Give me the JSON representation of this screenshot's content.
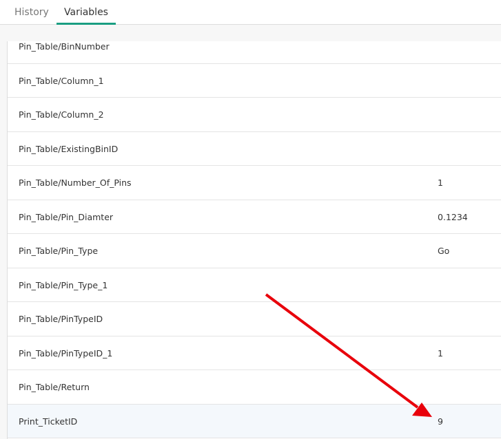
{
  "tabs": [
    {
      "label": "History"
    },
    {
      "label": "Variables",
      "active": true
    }
  ],
  "rows": [
    {
      "name": "Pin_Table/BinNumber",
      "value": ""
    },
    {
      "name": "Pin_Table/Column_1",
      "value": ""
    },
    {
      "name": "Pin_Table/Column_2",
      "value": ""
    },
    {
      "name": "Pin_Table/ExistingBinID",
      "value": ""
    },
    {
      "name": "Pin_Table/Number_Of_Pins",
      "value": "1"
    },
    {
      "name": "Pin_Table/Pin_Diamter",
      "value": "0.1234"
    },
    {
      "name": "Pin_Table/Pin_Type",
      "value": "Go"
    },
    {
      "name": "Pin_Table/Pin_Type_1",
      "value": ""
    },
    {
      "name": "Pin_Table/PinTypeID",
      "value": ""
    },
    {
      "name": "Pin_Table/PinTypeID_1",
      "value": "1"
    },
    {
      "name": "Pin_Table/Return",
      "value": ""
    },
    {
      "name": "Print_TicketID",
      "value": "9",
      "highlighted": true
    }
  ],
  "colors": {
    "accent": "#1a9e82",
    "annotation": "#e8000b"
  }
}
